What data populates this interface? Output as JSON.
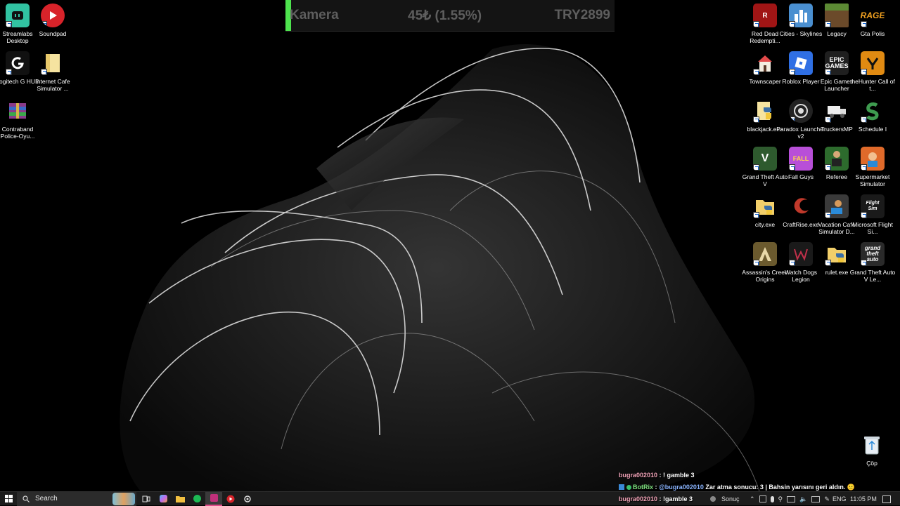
{
  "overlay": {
    "scene": "Kamera",
    "amount": "45₺ (1.55%)",
    "goal": "TRY2899"
  },
  "desktop": {
    "left_icons": [
      {
        "label": "Streamlabs Desktop",
        "icon": "streamlabs-icon",
        "color": "#31c3a2"
      },
      {
        "label": "Soundpad",
        "icon": "soundpad-icon",
        "color": "#d8232a"
      },
      {
        "label": "Logitech G HUB",
        "icon": "logitech-icon",
        "color": "#111111"
      },
      {
        "label": "Internet Cafe Simulator ...",
        "icon": "folder-icon",
        "color": "#e8c86a"
      },
      {
        "label": "Contraband Police-Oyu...",
        "icon": "winrar-icon",
        "color": "#8a3a8a"
      }
    ],
    "right_icons": [
      {
        "label": "Red Dead Redempti...",
        "icon": "rdr-icon",
        "color": "#a01515"
      },
      {
        "label": "Cities - Skylines",
        "icon": "cities-icon",
        "color": "#4a8fd0"
      },
      {
        "label": "Legacy",
        "icon": "minecraft-icon",
        "color": "#5c8a34"
      },
      {
        "label": "Gta Polis",
        "icon": "rage-icon",
        "color": "#000000"
      },
      {
        "label": "Townscaper",
        "icon": "townscaper-icon",
        "color": "#e44a4a"
      },
      {
        "label": "Roblox Player",
        "icon": "roblox-icon",
        "color": "#2f6fe4"
      },
      {
        "label": "Epic Games Launcher",
        "icon": "epic-icon",
        "color": "#1f1f1f"
      },
      {
        "label": "theHunter Call of t...",
        "icon": "hunter-icon",
        "color": "#e08a12"
      },
      {
        "label": "blackjack.exe",
        "icon": "python-icon",
        "color": "#3a6ea5"
      },
      {
        "label": "Paradox Launcher v2",
        "icon": "paradox-icon",
        "color": "#222222"
      },
      {
        "label": "TruckersMP",
        "icon": "truck-icon",
        "color": "#111111"
      },
      {
        "label": "Schedule I",
        "icon": "schedule-icon",
        "color": "#3e9b4f"
      },
      {
        "label": "Grand Theft Auto V",
        "icon": "gta5-icon",
        "color": "#2e5a2e"
      },
      {
        "label": "Fall Guys",
        "icon": "fallguys-icon",
        "color": "#b84fd8"
      },
      {
        "label": "Referee",
        "icon": "referee-icon",
        "color": "#2d6b2d"
      },
      {
        "label": "Supermarket Simulator",
        "icon": "supermarket-icon",
        "color": "#e06a2a"
      },
      {
        "label": "city.exe",
        "icon": "python-folder-icon",
        "color": "#e8c86a"
      },
      {
        "label": "CraftRise.exe",
        "icon": "craftrise-icon",
        "color": "#c0392b"
      },
      {
        "label": "Vacation Cafe Simulator D...",
        "icon": "vacation-icon",
        "color": "#3a3a3a"
      },
      {
        "label": "Microsoft Flight Si...",
        "icon": "flightsim-icon",
        "color": "#1a1a1a"
      },
      {
        "label": "Assassin's Creed Origins",
        "icon": "aco-icon",
        "color": "#6b5a2e"
      },
      {
        "label": "Watch Dogs Legion",
        "icon": "watchdogs-icon",
        "color": "#1a1a1a"
      },
      {
        "label": "rulet.exe",
        "icon": "python-folder-icon",
        "color": "#e8c86a"
      },
      {
        "label": "Grand Theft Auto V Le...",
        "icon": "gta5-legacy-icon",
        "color": "#2a2a2a"
      }
    ],
    "recycle_bin": {
      "label": "Çöp",
      "icon": "recycle-bin-icon"
    }
  },
  "chat": {
    "line1": {
      "user": "bugra002010",
      "message": " : ! gamble 3"
    },
    "line2": {
      "user": "BotRix",
      "mention": "@bugra002010",
      "message": " Zar atma sonucu: 3 | Bahsin yarısını geri aldın. 😐"
    },
    "line3": {
      "user": "bugra002010",
      "message": " : !gamble 3"
    }
  },
  "taskbar": {
    "search_placeholder": "Search",
    "weather_label": "Sonuç",
    "language": "ENG",
    "time": "11:05 PM"
  }
}
